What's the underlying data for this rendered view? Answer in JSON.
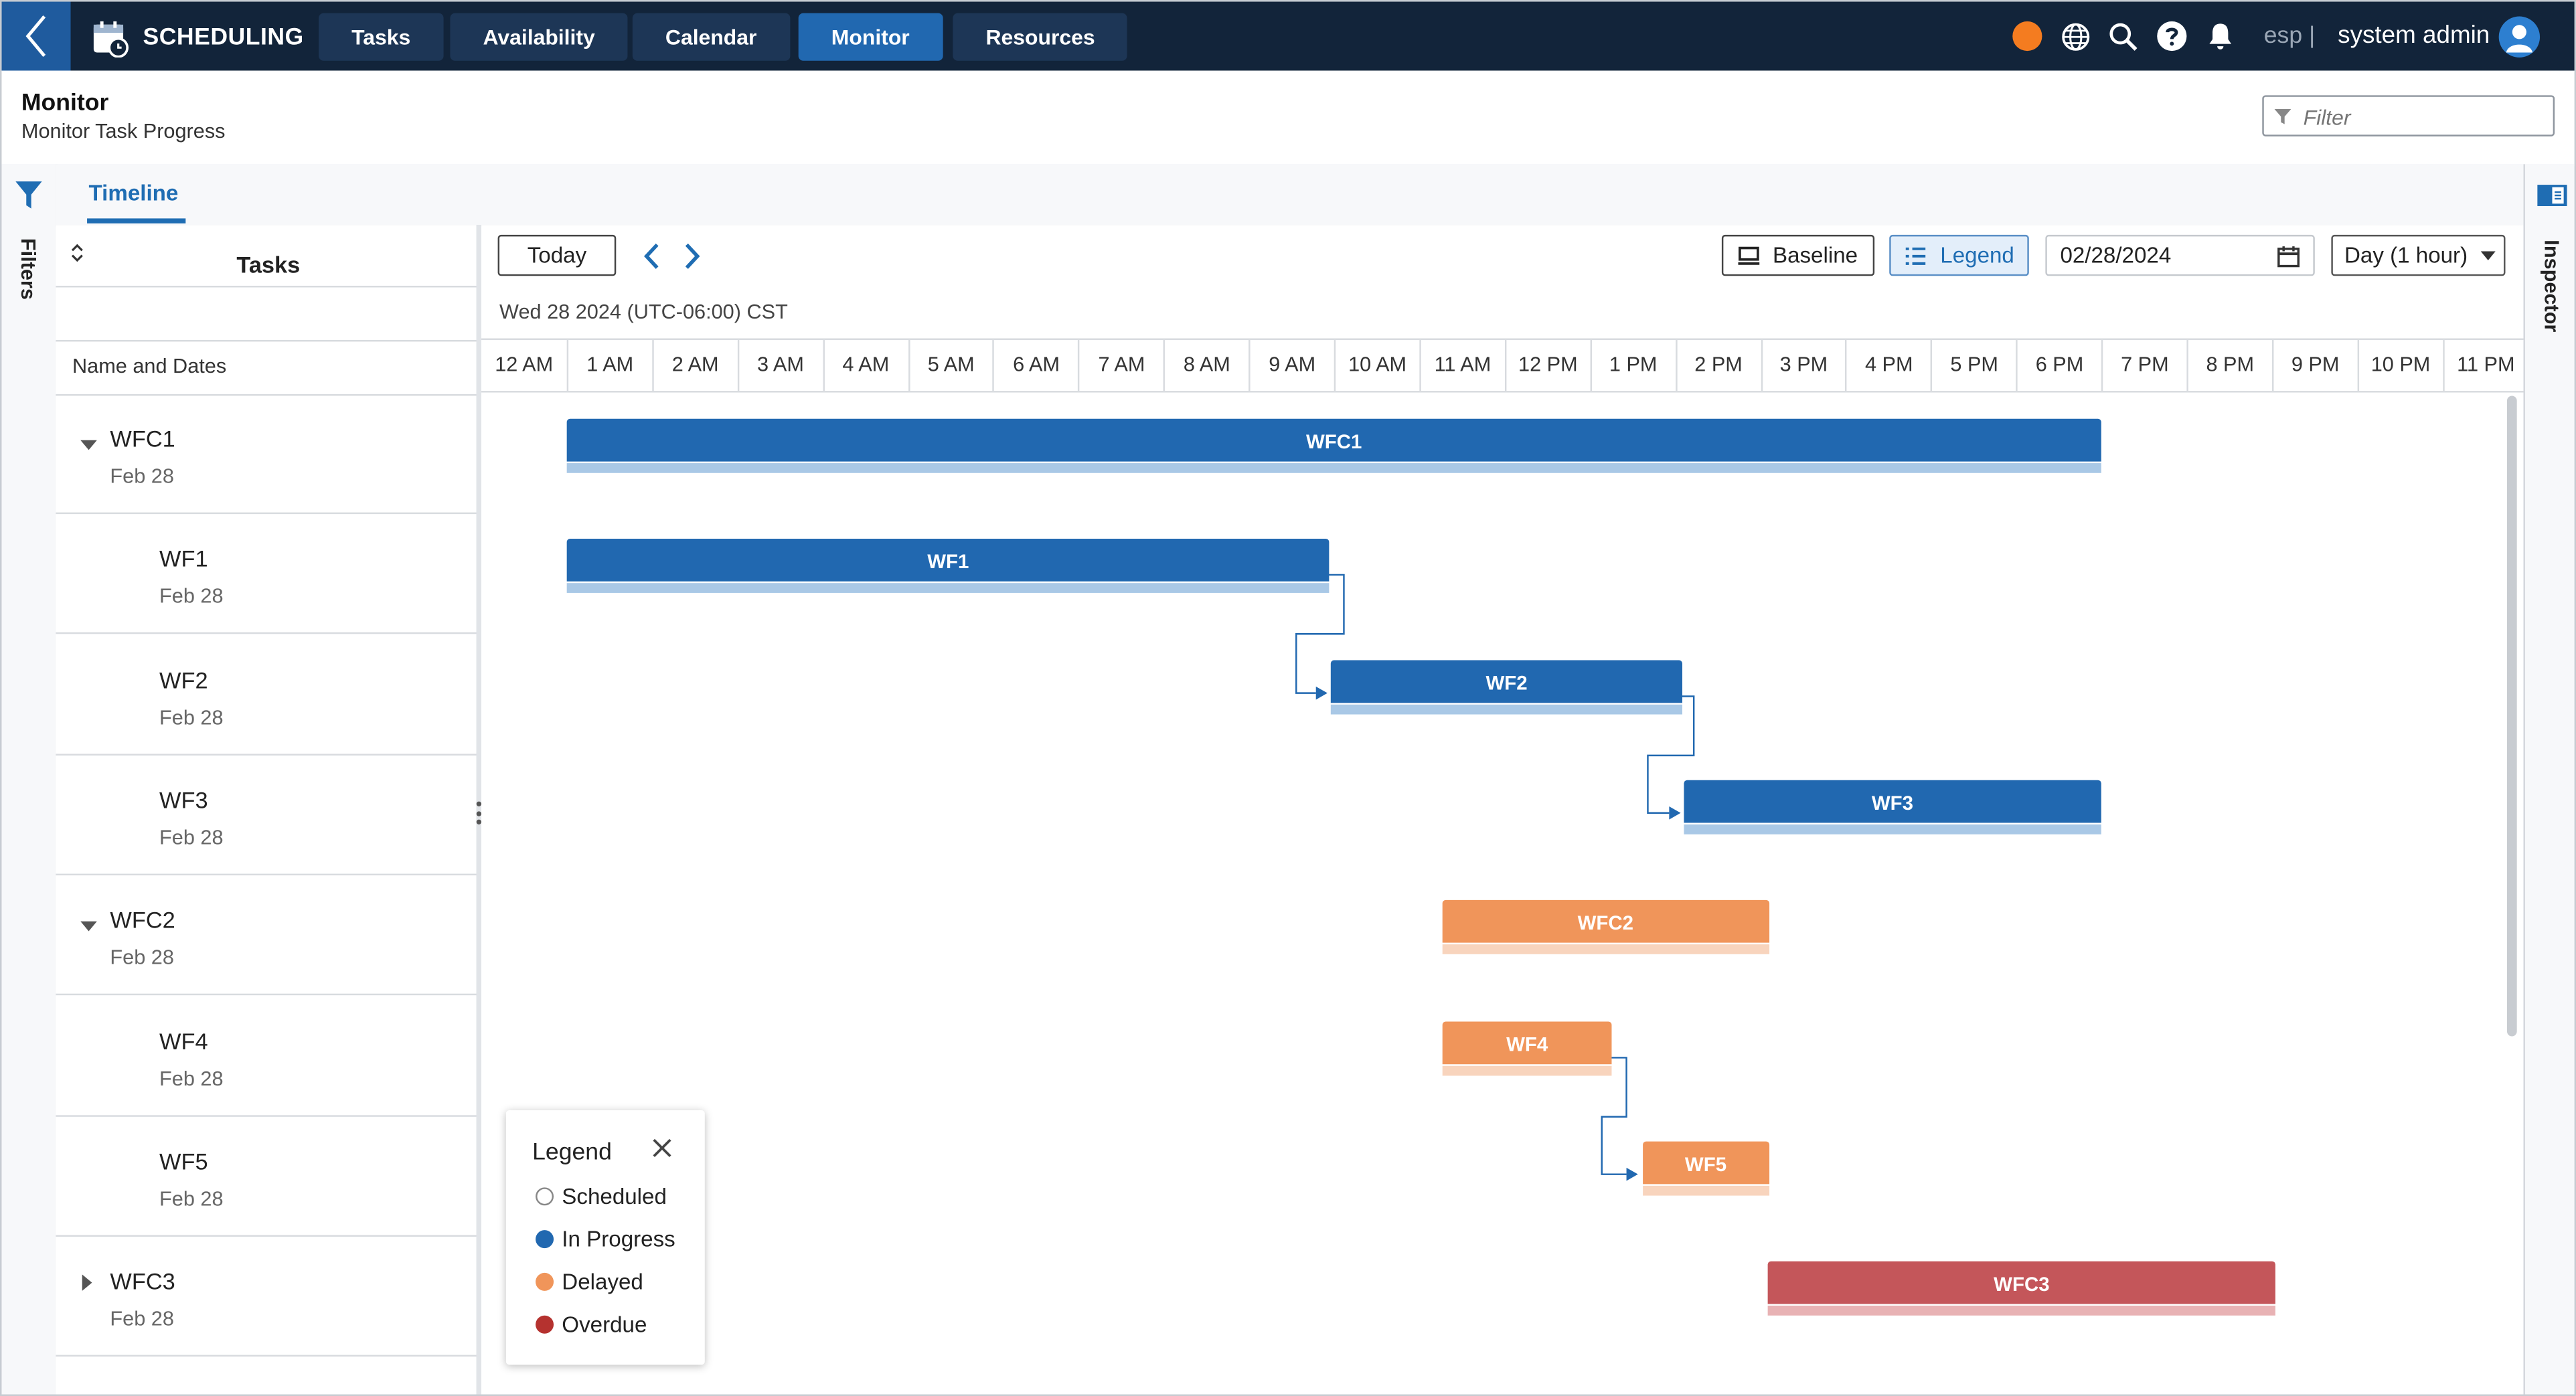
{
  "app": {
    "brand": "SCHEDULING",
    "nav": [
      "Tasks",
      "Availability",
      "Calendar",
      "Monitor",
      "Resources"
    ],
    "active_nav": "Monitor",
    "lang": "esp",
    "separator": "|",
    "user": "system admin",
    "status_color": "#f47c20"
  },
  "page": {
    "title": "Monitor",
    "subtitle": "Monitor Task Progress",
    "filter_placeholder": "Filter"
  },
  "rails": {
    "left_label": "Filters",
    "right_label": "Inspector"
  },
  "tabs": {
    "active": "Timeline"
  },
  "tasks_panel": {
    "title": "Tasks",
    "column_label": "Name and Dates",
    "rows": [
      {
        "name": "WFC1",
        "date": "Feb 28",
        "level": 0,
        "expanded": true
      },
      {
        "name": "WF1",
        "date": "Feb 28",
        "level": 1
      },
      {
        "name": "WF2",
        "date": "Feb 28",
        "level": 1
      },
      {
        "name": "WF3",
        "date": "Feb 28",
        "level": 1
      },
      {
        "name": "WFC2",
        "date": "Feb 28",
        "level": 0,
        "expanded": true
      },
      {
        "name": "WF4",
        "date": "Feb 28",
        "level": 1
      },
      {
        "name": "WF5",
        "date": "Feb 28",
        "level": 1
      },
      {
        "name": "WFC3",
        "date": "Feb 28",
        "level": 0,
        "expanded": false
      }
    ]
  },
  "toolbar": {
    "today": "Today",
    "baseline": "Baseline",
    "legend": "Legend",
    "date": "02/28/2024",
    "scale": "Day (1 hour)"
  },
  "timeline": {
    "date_header": "Wed 28 2024 (UTC-06:00) CST",
    "hours": [
      "12 AM",
      "1 AM",
      "2 AM",
      "3 AM",
      "4 AM",
      "5 AM",
      "6 AM",
      "7 AM",
      "8 AM",
      "9 AM",
      "10 AM",
      "11 AM",
      "12 PM",
      "1 PM",
      "2 PM",
      "3 PM",
      "4 PM",
      "5 PM",
      "6 PM",
      "7 PM",
      "8 PM",
      "9 PM",
      "10 PM",
      "11 PM"
    ],
    "bars": [
      {
        "label": "WFC1",
        "start_hour": 1.0,
        "end_hour": 19.0,
        "status": "In Progress"
      },
      {
        "label": "WF1",
        "start_hour": 1.0,
        "end_hour": 9.95,
        "status": "In Progress"
      },
      {
        "label": "WF2",
        "start_hour": 9.97,
        "end_hour": 14.08,
        "status": "In Progress"
      },
      {
        "label": "WF3",
        "start_hour": 14.1,
        "end_hour": 19.0,
        "status": "In Progress"
      },
      {
        "label": "WFC2",
        "start_hour": 11.27,
        "end_hour": 15.1,
        "status": "Delayed"
      },
      {
        "label": "WF4",
        "start_hour": 11.28,
        "end_hour": 13.25,
        "status": "Delayed"
      },
      {
        "label": "WF5",
        "start_hour": 13.62,
        "end_hour": 15.1,
        "status": "Delayed"
      },
      {
        "label": "WFC3",
        "start_hour": 15.08,
        "end_hour": 21.05,
        "status": "Overdue"
      }
    ]
  },
  "legend": {
    "title": "Legend",
    "items": [
      {
        "label": "Scheduled",
        "color": "#ffffff"
      },
      {
        "label": "In Progress",
        "color": "#2168b0"
      },
      {
        "label": "Delayed",
        "color": "#f0955a"
      },
      {
        "label": "Overdue",
        "color": "#b5322f"
      }
    ]
  }
}
